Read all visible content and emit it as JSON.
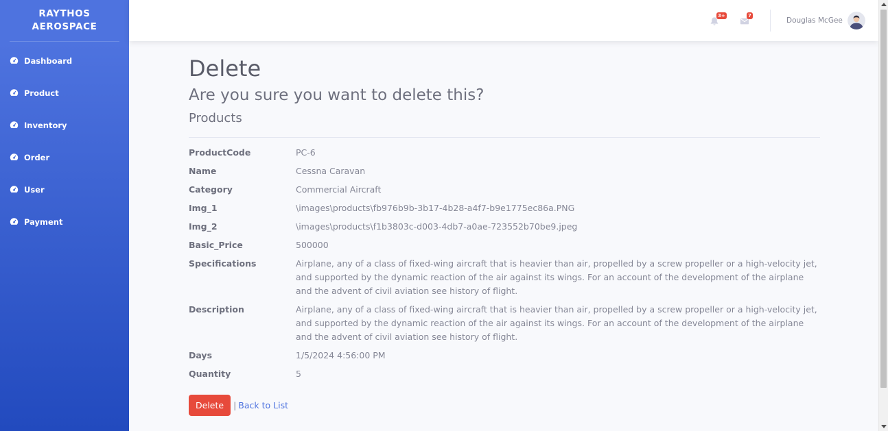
{
  "brand": {
    "line1": "RAYTHOS",
    "line2": "AEROSPACE"
  },
  "sidebar": {
    "items": [
      {
        "label": "Dashboard",
        "icon": "tachometer-icon"
      },
      {
        "label": "Product",
        "icon": "tachometer-icon"
      },
      {
        "label": "Inventory",
        "icon": "tachometer-icon"
      },
      {
        "label": "Order",
        "icon": "tachometer-icon"
      },
      {
        "label": "User",
        "icon": "tachometer-icon"
      },
      {
        "label": "Payment",
        "icon": "tachometer-icon"
      }
    ]
  },
  "topbar": {
    "alerts_badge": "3+",
    "messages_badge": "7",
    "user_name": "Douglas McGee"
  },
  "page": {
    "title": "Delete",
    "question": "Are you sure you want to delete this?",
    "entity": "Products"
  },
  "fields": [
    {
      "label": "ProductCode",
      "value": "PC-6"
    },
    {
      "label": "Name",
      "value": "Cessna Caravan"
    },
    {
      "label": "Category",
      "value": "Commercial Aircraft"
    },
    {
      "label": "Img_1",
      "value": "\\images\\products\\fb976b9b-3b17-4b28-a4f7-b9e1775ec86a.PNG"
    },
    {
      "label": "Img_2",
      "value": "\\images\\products\\f1b3803c-d003-4db7-a0ae-723552b70be9.jpeg"
    },
    {
      "label": "Basic_Price",
      "value": "500000"
    },
    {
      "label": "Specifications",
      "value": "Airplane, any of a class of fixed-wing aircraft that is heavier than air, propelled by a screw propeller or a high-velocity jet, and supported by the dynamic reaction of the air against its wings. For an account of the development of the airplane and the advent of civil aviation see history of flight."
    },
    {
      "label": "Description",
      "value": "Airplane, any of a class of fixed-wing aircraft that is heavier than air, propelled by a screw propeller or a high-velocity jet, and supported by the dynamic reaction of the air against its wings. For an account of the development of the airplane and the advent of civil aviation see history of flight."
    },
    {
      "label": "Days",
      "value": "1/5/2024 4:56:00 PM"
    },
    {
      "label": "Quantity",
      "value": "5"
    }
  ],
  "actions": {
    "delete_label": "Delete",
    "separator": "|",
    "back_label": "Back to List"
  },
  "colors": {
    "sidebar_start": "#4e73df",
    "sidebar_end": "#224abe",
    "danger": "#e74a3b",
    "link": "#4e73df"
  }
}
